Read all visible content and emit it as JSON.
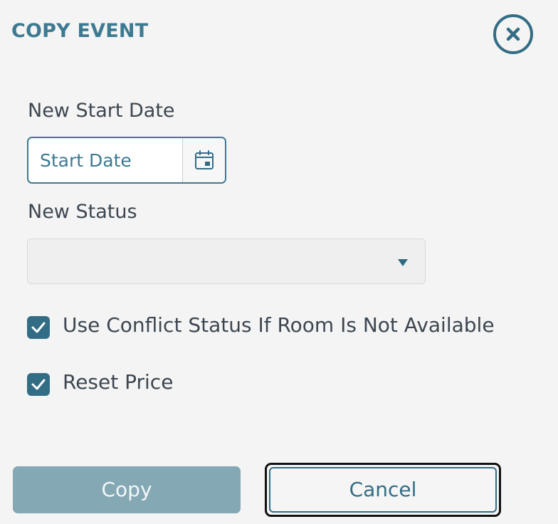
{
  "dialog": {
    "title": "COPY EVENT",
    "close_icon": "close-x-circle-icon"
  },
  "start_date": {
    "label": "New Start Date",
    "placeholder": "Start Date",
    "value": "",
    "calendar_icon": "calendar-icon"
  },
  "status": {
    "label": "New Status",
    "selected": "",
    "dropdown_icon": "caret-down-icon"
  },
  "options": [
    {
      "label": "Use Conflict Status If Room Is Not Available",
      "checked": true
    },
    {
      "label": "Reset Price",
      "checked": true
    }
  ],
  "actions": {
    "copy_label": "Copy",
    "cancel_label": "Cancel"
  },
  "colors": {
    "accent": "#336d85",
    "title": "#3d7a91",
    "copy_disabled_bg": "#84a8b4",
    "background": "#f4f4f4"
  }
}
